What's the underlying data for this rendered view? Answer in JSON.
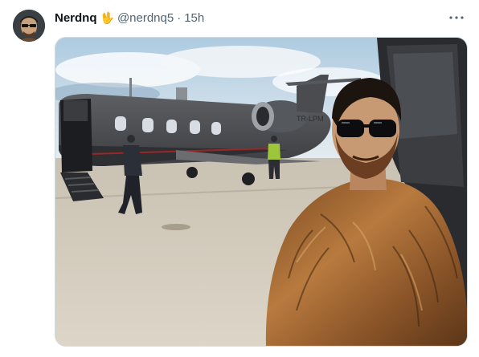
{
  "post": {
    "display_name": "Nerdnq",
    "name_emoji": "🖖",
    "handle": "@nerdnq5",
    "separator": "·",
    "time": "15h",
    "more_label": "···"
  },
  "media": {
    "plane_registration": "TR-LPM"
  },
  "colors": {
    "text_primary": "#0f1419",
    "text_secondary": "#536471",
    "border": "#cfd9de"
  }
}
